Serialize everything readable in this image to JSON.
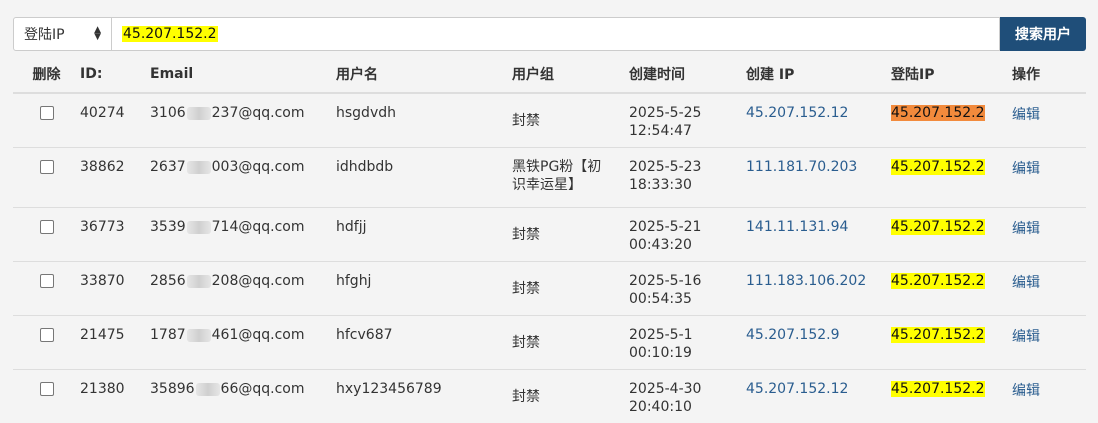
{
  "search": {
    "select_value": "登陆IP",
    "query": "45.207.152.2",
    "button": "搜索用户"
  },
  "table": {
    "headers": [
      "删除",
      "ID:",
      "Email",
      "用户名",
      "用户组",
      "创建时间",
      "创建 IP",
      "登陆IP",
      "操作"
    ],
    "rows": [
      {
        "id": "40274",
        "email_prefix": "3106",
        "email_suffix": "237@qq.com",
        "username": "hsgdvdh",
        "group": "封禁",
        "created_date": "2025-5-25",
        "created_time": "12:54:47",
        "create_ip": "45.207.152.12",
        "login_ip": "45.207.152.2",
        "action": "编辑"
      },
      {
        "id": "38862",
        "email_prefix": "2637",
        "email_suffix": "003@qq.com",
        "username": "idhdbdb",
        "group": "黑铁PG粉【初识幸运星】",
        "created_date": "2025-5-23",
        "created_time": "18:33:30",
        "create_ip": "111.181.70.203",
        "login_ip": "45.207.152.2",
        "action": "编辑"
      },
      {
        "id": "36773",
        "email_prefix": "3539",
        "email_suffix": "714@qq.com",
        "username": "hdfjj",
        "group": "封禁",
        "created_date": "2025-5-21",
        "created_time": "00:43:20",
        "create_ip": "141.11.131.94",
        "login_ip": "45.207.152.2",
        "action": "编辑"
      },
      {
        "id": "33870",
        "email_prefix": "2856",
        "email_suffix": "208@qq.com",
        "username": "hfghj",
        "group": "封禁",
        "created_date": "2025-5-16",
        "created_time": "00:54:35",
        "create_ip": "111.183.106.202",
        "login_ip": "45.207.152.2",
        "action": "编辑"
      },
      {
        "id": "21475",
        "email_prefix": "1787",
        "email_suffix": "461@qq.com",
        "username": "hfcv687",
        "group": "封禁",
        "created_date": "2025-5-1",
        "created_time": "00:10:19",
        "create_ip": "45.207.152.9",
        "login_ip": "45.207.152.2",
        "action": "编辑"
      },
      {
        "id": "21380",
        "email_prefix": "35896",
        "email_suffix": "66@qq.com",
        "username": "hxy123456789",
        "group": "封禁",
        "created_date": "2025-4-30",
        "created_time": "20:40:10",
        "create_ip": "45.207.152.12",
        "login_ip": "45.207.152.2",
        "action": "编辑"
      }
    ]
  },
  "colors": {
    "highlight_yellow": "#ffff00",
    "highlight_orange": "#f28a3c",
    "button_bg": "#1f4e79",
    "link": "#2a5d8f"
  }
}
